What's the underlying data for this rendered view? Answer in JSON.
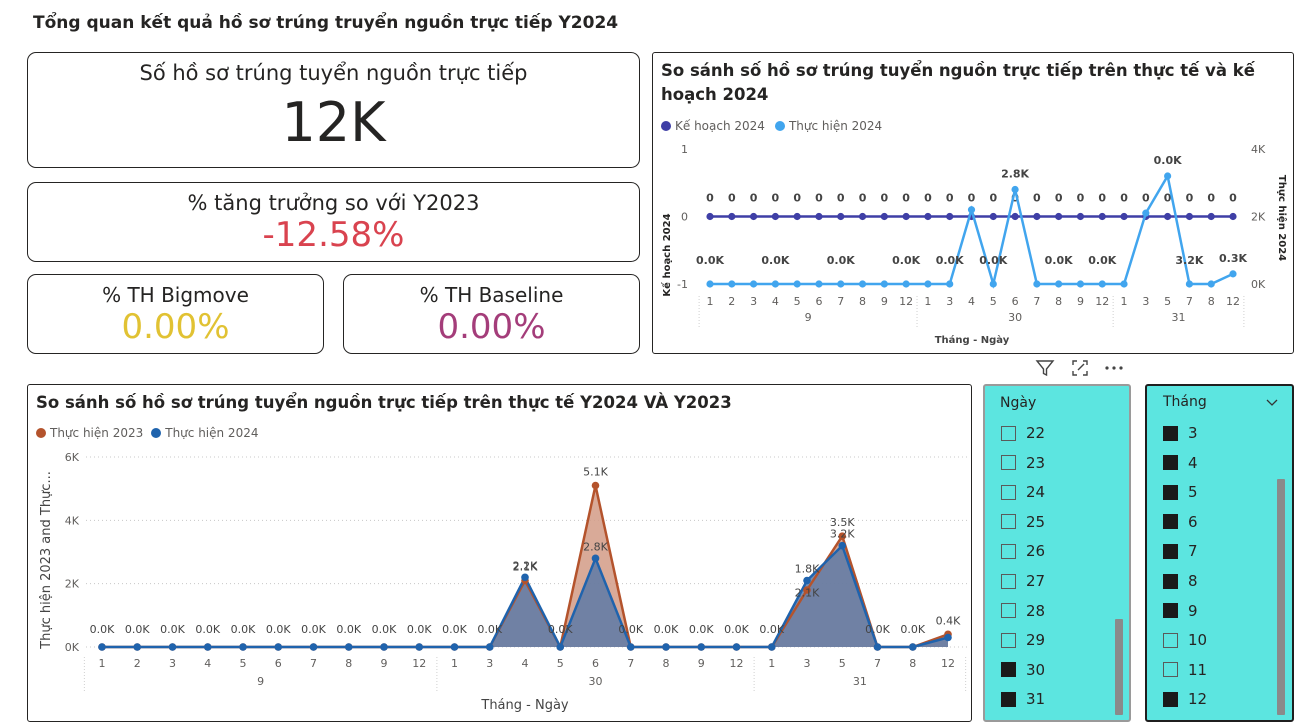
{
  "page": {
    "title": "Tổng quan kết quả hồ sơ trúng truyển nguồn trực tiếp Y2024"
  },
  "kpis": {
    "total": {
      "label": "Số hồ sơ trúng tuyển nguồn trực tiếp",
      "value": "12K"
    },
    "growth": {
      "label": "% tăng trưởng so với Y2023",
      "value": "-12.58%"
    },
    "bigmove": {
      "label": "% TH Bigmove",
      "value": "0.00%"
    },
    "baseline": {
      "label": "% TH Baseline",
      "value": "0.00%"
    }
  },
  "colors": {
    "plan": "#3f3fa6",
    "actual2024_top": "#41a5ee",
    "actual2023": "#b4532c",
    "actual2024": "#1f63ad",
    "growth_red": "#d9434f",
    "bigmove_yellow": "#e1c233",
    "baseline_purple": "#a43d7a",
    "slicer_bg": "#5ce5e0"
  },
  "toolbar": {
    "filter_icon": "filter-icon",
    "focus_icon": "focus-mode-icon",
    "more_icon": "more-options-icon"
  },
  "top_chart": {
    "title": "So sánh số hồ sơ trúng tuyển nguồn trực tiếp trên thực tế và kế hoạch 2024",
    "legend": [
      "Kế hoạch 2024",
      "Thực hiện 2024"
    ],
    "left_axis_label": "Kế hoạch 2024",
    "right_axis_label": "Thực hiện 2024",
    "x_axis_label": "Tháng - Ngày",
    "left_ticks": [
      "1",
      "0",
      "-1"
    ],
    "right_ticks": [
      "4K",
      "2K",
      "0K"
    ],
    "group_labels": [
      "9",
      "30",
      "31"
    ],
    "month_labels": [
      "1",
      "2",
      "3",
      "4",
      "5",
      "6",
      "7",
      "8",
      "9",
      "12",
      "1",
      "3",
      "4",
      "5",
      "6",
      "7",
      "8",
      "9",
      "12",
      "1",
      "3",
      "5",
      "7",
      "8",
      "12"
    ],
    "plan_labels": [
      "0",
      "0",
      "0",
      "0",
      "0",
      "0",
      "0",
      "0",
      "0",
      "0",
      "0",
      "0",
      "0",
      "0",
      "0",
      "0",
      "0",
      "0",
      "0",
      "0",
      "0",
      "0",
      "0",
      "0",
      "0"
    ],
    "actual_label_list": [
      {
        "idx": 0,
        "text": "0.0K"
      },
      {
        "idx": 3,
        "text": "0.0K"
      },
      {
        "idx": 6,
        "text": "0.0K"
      },
      {
        "idx": 9,
        "text": "0.0K"
      },
      {
        "idx": 11,
        "text": "0.0K"
      },
      {
        "idx": 13,
        "text": "0.0K"
      },
      {
        "idx": 14,
        "text": "2.8K"
      },
      {
        "idx": 16,
        "text": "0.0K"
      },
      {
        "idx": 18,
        "text": "0.0K"
      },
      {
        "idx": 22,
        "text": "3.2K"
      },
      {
        "idx": 21,
        "text": "0.0K"
      },
      {
        "idx": 24,
        "text": "0.3K"
      }
    ]
  },
  "chart_data": [
    {
      "type": "line",
      "title": "So sánh số hồ sơ trúng tuyển nguồn trực tiếp trên thực tế và kế hoạch 2024",
      "xlabel": "Tháng - Ngày",
      "ylabel": "Kế hoạch 2024",
      "y2label": "Thực hiện 2024",
      "ylim": [
        -1,
        1
      ],
      "y2lim": [
        0,
        4000
      ],
      "categories": [
        "9-1",
        "9-2",
        "9-3",
        "9-4",
        "9-5",
        "9-6",
        "9-7",
        "9-8",
        "9-9",
        "9-12",
        "30-1",
        "30-3",
        "30-4",
        "30-5",
        "30-6",
        "30-7",
        "30-8",
        "30-9",
        "30-12",
        "31-1",
        "31-3",
        "31-5",
        "31-7",
        "31-8",
        "31-12"
      ],
      "series": [
        {
          "name": "Kế hoạch 2024",
          "axis": "left",
          "values": [
            0,
            0,
            0,
            0,
            0,
            0,
            0,
            0,
            0,
            0,
            0,
            0,
            0,
            0,
            0,
            0,
            0,
            0,
            0,
            0,
            0,
            0,
            0,
            0,
            0
          ]
        },
        {
          "name": "Thực hiện 2024",
          "axis": "right",
          "values": [
            0,
            0,
            0,
            0,
            0,
            0,
            0,
            0,
            0,
            0,
            0,
            0,
            2200,
            0,
            2800,
            0,
            0,
            0,
            0,
            0,
            2100,
            3200,
            0,
            0,
            300
          ]
        }
      ],
      "legend_position": "top-left"
    },
    {
      "type": "area",
      "title": "So sánh số hồ sơ trúng tuyển nguồn trực tiếp trên thực tế Y2024 VÀ Y2023",
      "xlabel": "Tháng - Ngày",
      "ylabel": "Thực hiện 2023 and Thực...",
      "ylim": [
        0,
        6000
      ],
      "yticks": [
        "0K",
        "2K",
        "4K",
        "6K"
      ],
      "categories": [
        "9-1",
        "9-2",
        "9-3",
        "9-4",
        "9-5",
        "9-6",
        "9-7",
        "9-8",
        "9-9",
        "9-12",
        "30-1",
        "30-3",
        "30-4",
        "30-5",
        "30-6",
        "30-7",
        "30-8",
        "30-9",
        "30-12",
        "31-1",
        "31-3",
        "31-5",
        "31-7",
        "31-8",
        "31-12"
      ],
      "series": [
        {
          "name": "Thực hiện 2023",
          "values": [
            0,
            0,
            0,
            0,
            0,
            0,
            0,
            0,
            0,
            0,
            0,
            0,
            2100,
            0,
            5100,
            0,
            0,
            0,
            0,
            0,
            1800,
            3500,
            0,
            0,
            400
          ]
        },
        {
          "name": "Thực hiện 2024",
          "values": [
            0,
            0,
            0,
            0,
            0,
            0,
            0,
            0,
            0,
            0,
            0,
            0,
            2200,
            0,
            2800,
            0,
            0,
            0,
            0,
            0,
            2100,
            3200,
            0,
            0,
            300
          ]
        }
      ],
      "legend_position": "top-left"
    }
  ],
  "bottom_chart": {
    "title": "So sánh số hồ sơ trúng tuyển nguồn trực tiếp trên thực tế Y2024 VÀ Y2023",
    "legend": [
      "Thực hiện 2023",
      "Thực hiện 2024"
    ],
    "y_axis_label": "Thực hiện 2023 and Thực...",
    "x_axis_label": "Tháng - Ngày",
    "y_ticks": [
      "6K",
      "4K",
      "2K",
      "0K"
    ],
    "group_labels": [
      "9",
      "30",
      "31"
    ],
    "month_labels": [
      "1",
      "2",
      "3",
      "4",
      "5",
      "6",
      "7",
      "8",
      "9",
      "12",
      "1",
      "3",
      "4",
      "5",
      "6",
      "7",
      "8",
      "9",
      "12",
      "1",
      "3",
      "5",
      "7",
      "8",
      "12"
    ],
    "labels_2023": [
      {
        "idx": 12,
        "text": "2.1K"
      },
      {
        "idx": 14,
        "text": "5.1K"
      },
      {
        "idx": 21,
        "text": "3.5K"
      },
      {
        "idx": 24,
        "text": "0.4K"
      }
    ],
    "labels_2024": [
      {
        "idx": 12,
        "text": "2.2K"
      },
      {
        "idx": 14,
        "text": "2.8K"
      },
      {
        "idx": 20,
        "text": "1.8K"
      },
      {
        "idx": 21,
        "text": "3.2K"
      },
      {
        "idx": 20,
        "text": "2.1K",
        "under": true
      }
    ],
    "zero_label": "0.0K"
  },
  "slicer_day": {
    "header": "Ngày",
    "items": [
      {
        "label": "22",
        "checked": false
      },
      {
        "label": "23",
        "checked": false
      },
      {
        "label": "24",
        "checked": false
      },
      {
        "label": "25",
        "checked": false
      },
      {
        "label": "26",
        "checked": false
      },
      {
        "label": "27",
        "checked": false
      },
      {
        "label": "28",
        "checked": false
      },
      {
        "label": "29",
        "checked": false
      },
      {
        "label": "30",
        "checked": true
      },
      {
        "label": "31",
        "checked": true
      }
    ]
  },
  "slicer_month": {
    "header": "Tháng",
    "items": [
      {
        "label": "3",
        "checked": true
      },
      {
        "label": "4",
        "checked": true
      },
      {
        "label": "5",
        "checked": true
      },
      {
        "label": "6",
        "checked": true
      },
      {
        "label": "7",
        "checked": true
      },
      {
        "label": "8",
        "checked": true
      },
      {
        "label": "9",
        "checked": true
      },
      {
        "label": "10",
        "checked": false
      },
      {
        "label": "11",
        "checked": false
      },
      {
        "label": "12",
        "checked": true
      }
    ]
  }
}
